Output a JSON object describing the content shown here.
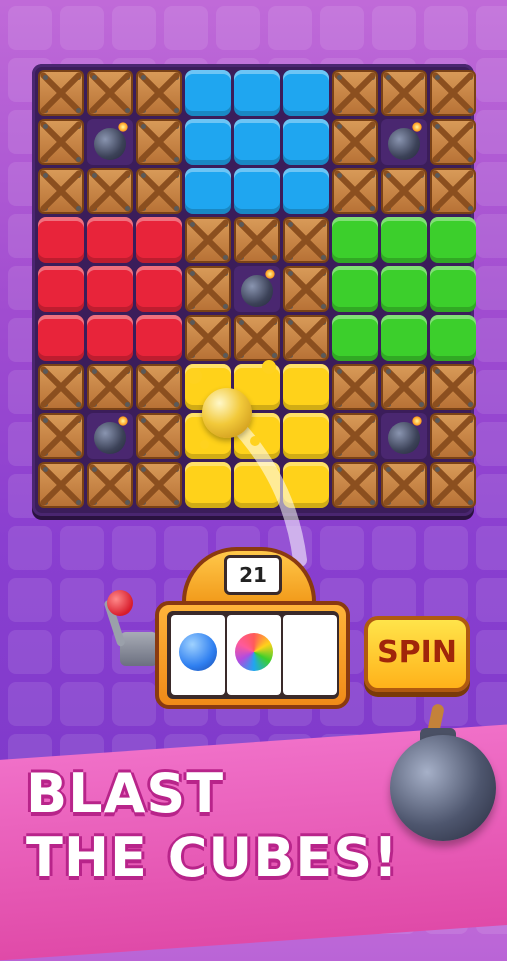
{
  "game": {
    "board": {
      "rows": 9,
      "cols": 9,
      "grid": [
        [
          "crate",
          "crate",
          "crate",
          "blue",
          "blue",
          "blue",
          "crate",
          "crate",
          "crate"
        ],
        [
          "crate",
          "bomb",
          "crate",
          "blue",
          "blue",
          "blue",
          "crate",
          "bomb",
          "crate"
        ],
        [
          "crate",
          "crate",
          "crate",
          "blue",
          "blue",
          "blue",
          "crate",
          "crate",
          "crate"
        ],
        [
          "red",
          "red",
          "red",
          "crate",
          "crate",
          "crate",
          "green",
          "green",
          "green"
        ],
        [
          "red",
          "red",
          "red",
          "crate",
          "bomb",
          "crate",
          "green",
          "green",
          "green"
        ],
        [
          "red",
          "red",
          "red",
          "crate",
          "crate",
          "crate",
          "green",
          "green",
          "green"
        ],
        [
          "crate",
          "crate",
          "crate",
          "yellow",
          "yellow",
          "yellow",
          "crate",
          "crate",
          "crate"
        ],
        [
          "crate",
          "bomb",
          "crate",
          "yellow",
          "yellow",
          "yellow",
          "crate",
          "bomb",
          "crate"
        ],
        [
          "crate",
          "crate",
          "crate",
          "yellow",
          "yellow",
          "yellow",
          "crate",
          "crate",
          "crate"
        ]
      ]
    },
    "colors": {
      "blue": "#1fa6f0",
      "red": "#e8243a",
      "green": "#3ccf2c",
      "yellow": "#ffd21a",
      "board": "#3b1d5a"
    },
    "slot_machine": {
      "counter": "21",
      "reels": [
        {
          "symbol": "blue-ball-icon",
          "color": "#2f7ff0"
        },
        {
          "symbol": "rainbow-ball-icon",
          "color": "#ff5a9a"
        },
        {
          "symbol": "empty",
          "color": "#ffffff"
        }
      ],
      "spin_label": "SPIN"
    },
    "headline": {
      "line1": "BLAST",
      "line2": "THE CUBES!"
    }
  }
}
